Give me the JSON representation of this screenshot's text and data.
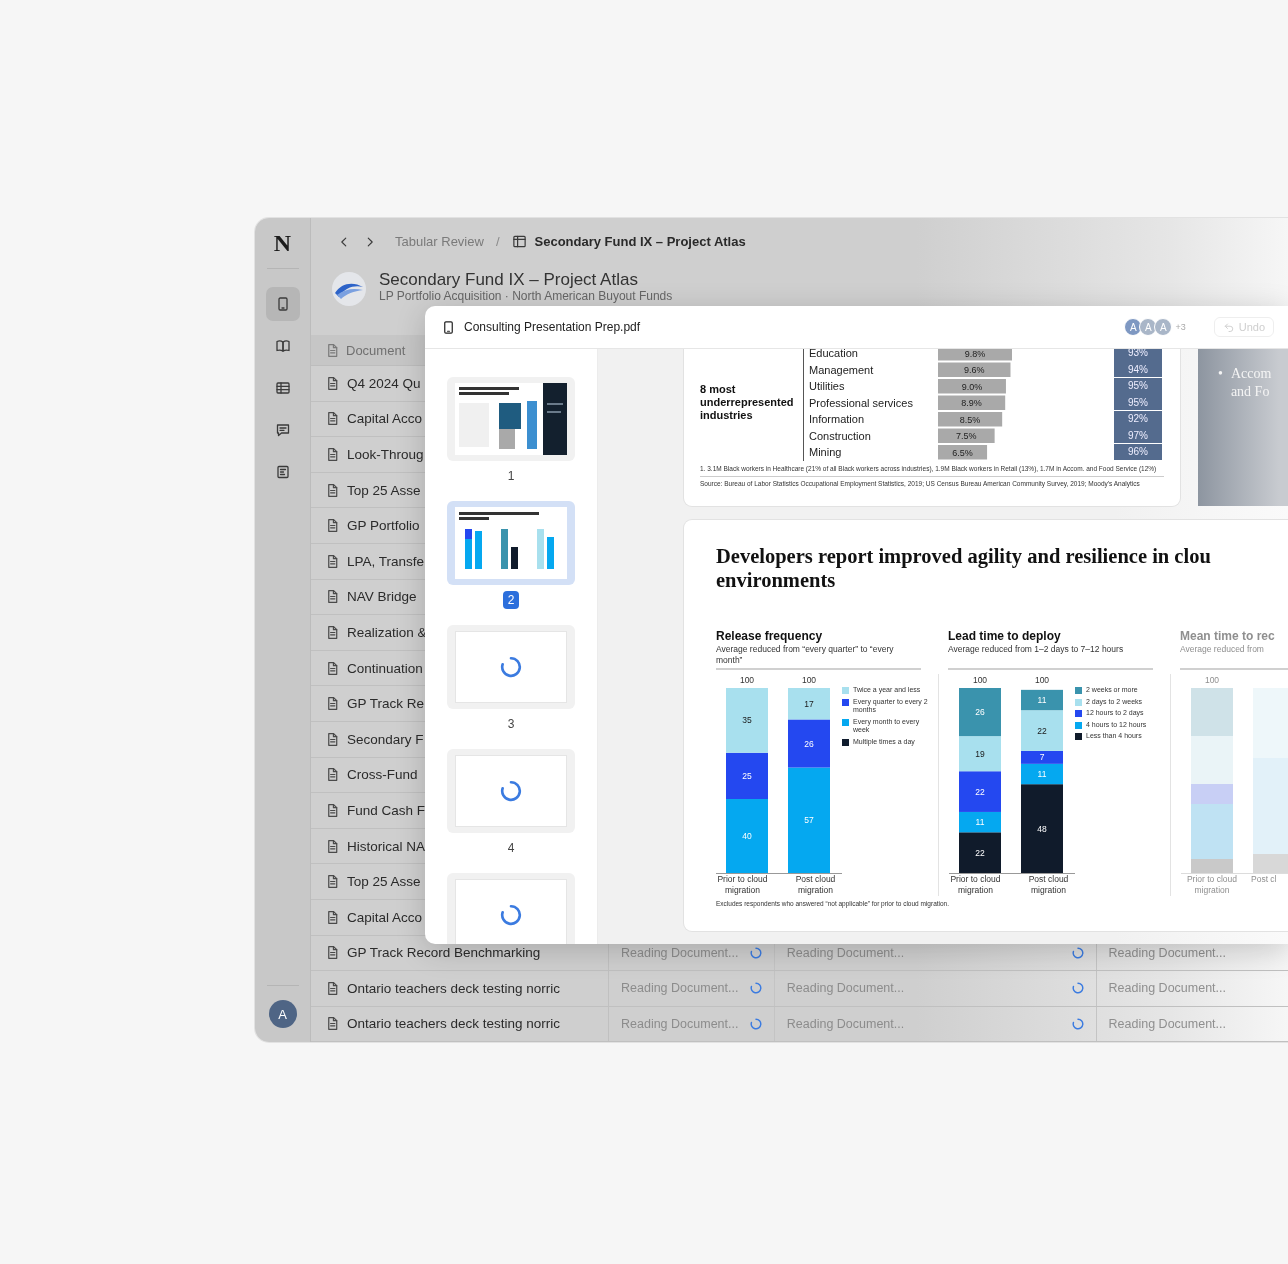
{
  "rail": {
    "logo": "N",
    "items": [
      {
        "selected": true
      },
      {
        "selected": false
      },
      {
        "selected": false
      },
      {
        "selected": false
      },
      {
        "selected": false
      }
    ],
    "avatar": "A"
  },
  "breadcrumb": {
    "parent": "Tabular Review",
    "separator": "/",
    "current": "Secondary Fund IX – Project Atlas"
  },
  "header": {
    "title": "Secondary Fund IX – Project Atlas",
    "subtitle": "LP Portfolio Acquisition · North American Buyout Funds"
  },
  "table": {
    "columns": [
      "Document"
    ],
    "rows": [
      {
        "document": "Q4 2024 Qu"
      },
      {
        "document": "Capital Acco"
      },
      {
        "document": "Look-Throug"
      },
      {
        "document": "Top 25 Asse"
      },
      {
        "document": "GP Portfolio"
      },
      {
        "document": "LPA, Transfe"
      },
      {
        "document": "NAV Bridge"
      },
      {
        "document": "Realization &"
      },
      {
        "document": "Continuation"
      },
      {
        "document": "GP Track Re"
      },
      {
        "document": "Secondary F"
      },
      {
        "document": "Cross-Fund"
      },
      {
        "document": "Fund Cash F"
      },
      {
        "document": "Historical NA"
      },
      {
        "document": "Top 25 Asse"
      },
      {
        "document": "Capital Acco"
      },
      {
        "document": "GP Track Record Benchmarking",
        "cells": [
          {
            "text": "Reading Document...",
            "spinner": true
          },
          {
            "text": "Reading Document...",
            "spinner": true
          },
          {
            "text": "Reading Document...",
            "spinner": false
          }
        ]
      },
      {
        "document": "Ontario teachers deck testing norric",
        "cells": [
          {
            "text": "Reading Document...",
            "spinner": true
          },
          {
            "text": "Reading Document...",
            "spinner": true
          },
          {
            "text": "Reading Document...",
            "spinner": false
          }
        ]
      },
      {
        "document": "Ontario teachers deck testing norric",
        "cells": [
          {
            "text": "Reading Document...",
            "spinner": true
          },
          {
            "text": "Reading Document...",
            "spinner": true
          },
          {
            "text": "Reading Document...",
            "spinner": false
          }
        ]
      }
    ]
  },
  "viewer": {
    "file_name": "Consulting Presentation Prep.pdf",
    "avatars": [
      "A",
      "A",
      "A"
    ],
    "more": "+3",
    "undo": "Undo",
    "pages": [
      {
        "number": "1",
        "kind": "preview",
        "selected": false
      },
      {
        "number": "2",
        "kind": "preview",
        "selected": true
      },
      {
        "number": "3",
        "kind": "loading",
        "selected": false
      },
      {
        "number": "4",
        "kind": "loading",
        "selected": false
      },
      {
        "kind": "loading",
        "selected": false
      }
    ]
  },
  "slide1": {
    "group_label": "8 most underrepresented industries",
    "chart_data": {
      "type": "bar",
      "orientation": "horizontal",
      "categories": [
        "Education",
        "Management",
        "Utilities",
        "Professional services",
        "Information",
        "Construction",
        "Mining"
      ],
      "values": [
        9.8,
        9.6,
        9.0,
        8.9,
        8.5,
        7.5,
        6.5
      ],
      "value_labels": [
        "9.8%",
        "9.6%",
        "9.0%",
        "8.9%",
        "8.5%",
        "7.5%",
        "6.5%"
      ]
    },
    "percents": [
      "93%",
      "94%",
      "95%",
      "95%",
      "92%",
      "97%",
      "96%"
    ],
    "footnote": "1.   3.1M Black workers in Healthcare (21% of all Black workers across industries), 1.9M Black workers in Retail (13%), 1.7M in Accom. and Food Service (12%)",
    "source": "Source: Bureau of Labor Statistics Occupational Employment Statistics, 2019; US Census Bureau American Community Survey, 2019; Moody's Analytics",
    "side_bullet": "•",
    "side_lines": [
      "Accom",
      "and Fo"
    ]
  },
  "slide2": {
    "title_lines": [
      "Developers report improved agility and resilience in clou",
      "environments"
    ],
    "panels": [
      {
        "title": "Release frequency",
        "subtitle": "Average reduced from “every quarter” to “every month”",
        "totals": [
          "100",
          "100"
        ],
        "chart_data": {
          "type": "bar",
          "stacked": true,
          "data_labels": true,
          "categories": [
            "Prior to cloud migration",
            "Post cloud migration"
          ],
          "series": [
            {
              "name": "Multiple times a day",
              "color": "#0f1c2e",
              "values": [
                null,
                null
              ]
            },
            {
              "name": "Every month to every week",
              "color": "#05a8f0",
              "values": [
                40,
                57
              ]
            },
            {
              "name": "Every quarter to every 2 months",
              "color": "#2448f0",
              "values": [
                25,
                26
              ]
            },
            {
              "name": "Twice a year and less",
              "color": "#a8e0ee",
              "values": [
                35,
                17
              ]
            }
          ]
        }
      },
      {
        "title": "Lead time to deploy",
        "subtitle": "Average reduced from 1–2 days to 7–12 hours",
        "totals": [
          "100",
          "100"
        ],
        "chart_data": {
          "type": "bar",
          "stacked": true,
          "data_labels": true,
          "categories": [
            "Prior to cloud migration",
            "Post cloud migration"
          ],
          "series": [
            {
              "name": "Less than 4 hours",
              "color": "#101b2b",
              "values": [
                22,
                48
              ]
            },
            {
              "name": "4 hours to 12 hours",
              "color": "#05a8f0",
              "values": [
                11,
                11
              ]
            },
            {
              "name": "12 hours to 2 days",
              "color": "#2448f0",
              "values": [
                22,
                7
              ]
            },
            {
              "name": "2 days to 2 weeks",
              "color": "#a8e0ee",
              "values": [
                19,
                22
              ]
            },
            {
              "name": "2 weeks or more",
              "color": "#3a93ad",
              "values": [
                26,
                11
              ]
            }
          ]
        }
      }
    ],
    "faded_panel": {
      "title": "Mean time to rec",
      "subtitle": "Average reduced from",
      "totals": [
        "100"
      ],
      "categories": [
        "Prior to cloud migration",
        "Post cl"
      ]
    },
    "footnote": "Excludes respondents who answered “not applicable” for prior to cloud migration."
  }
}
